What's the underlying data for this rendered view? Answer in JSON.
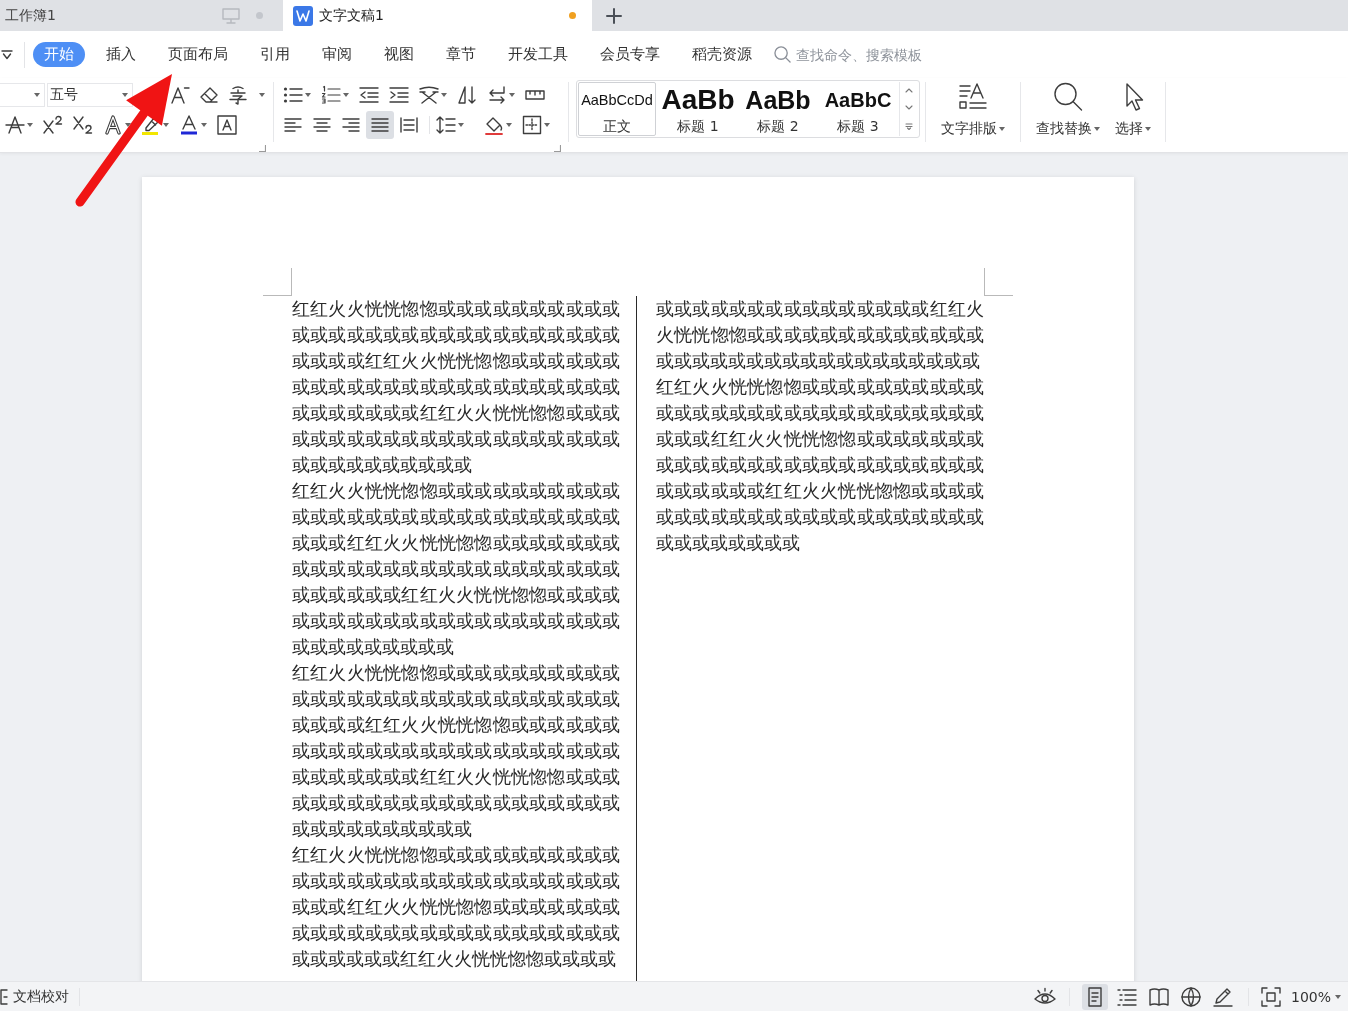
{
  "tabs": [
    {
      "label": "工作簿1",
      "kind": "spreadsheet",
      "selected": false,
      "unsaved": true
    },
    {
      "label": "文字文稿1",
      "kind": "document",
      "selected": true,
      "unsaved": true
    }
  ],
  "ribbon_tabs": [
    {
      "label": "开始",
      "selected": true
    },
    {
      "label": "插入",
      "selected": false
    },
    {
      "label": "页面布局",
      "selected": false
    },
    {
      "label": "引用",
      "selected": false
    },
    {
      "label": "审阅",
      "selected": false
    },
    {
      "label": "视图",
      "selected": false
    },
    {
      "label": "章节",
      "selected": false
    },
    {
      "label": "开发工具",
      "selected": false
    },
    {
      "label": "会员专享",
      "selected": false
    },
    {
      "label": "稻壳资源",
      "selected": false
    }
  ],
  "search": {
    "placeholder": "查找命令、搜索模板"
  },
  "font_group": {
    "font_size": "五号"
  },
  "paragraph_group": {
    "alignment": [
      {
        "kind": "left",
        "selected": false
      },
      {
        "kind": "center",
        "selected": false
      },
      {
        "kind": "right",
        "selected": false
      },
      {
        "kind": "justify",
        "selected": true
      },
      {
        "kind": "distributed",
        "selected": false
      }
    ]
  },
  "styles": [
    {
      "kind": "body",
      "sample": "AaBbCcDd",
      "label": "正文",
      "selected": true
    },
    {
      "kind": "heading-1",
      "sample": "AaBb",
      "label": "标题 1",
      "selected": false
    },
    {
      "kind": "heading-2",
      "sample": "AaBb",
      "label": "标题 2",
      "selected": false
    },
    {
      "kind": "heading-3",
      "sample": "AaBbC",
      "label": "标题 3",
      "selected": false
    }
  ],
  "tool_groups": [
    [
      {
        "kind": "text-layout",
        "label": "文字排版"
      }
    ],
    [
      {
        "kind": "find-replace",
        "label": "查找替换"
      },
      {
        "kind": "select",
        "label": "选择"
      }
    ]
  ],
  "document": {
    "columns": [
      {
        "paragraphs": [
          "红红火火恍恍惚惚或或或或或或或或或或或或或或或或或或或或或或或或或或或或或或或或红红火火恍恍惚惚或或或或或或或或或或或或或或或或或或或或或或或或或或或或或或或红红火火恍恍惚惚或或或或或或或或或或或或或或或或或或或或或或或或或或或或或或或",
          "红红火火恍恍惚惚或或或或或或或或或或或或或或或或或或或或或或或或或或或或或或或红红火火恍恍惚惚或或或或或或或或或或或或或或或或或或或或或或或或或或或或或或或红红火火恍恍惚惚或或或或或或或或或或或或或或或或或或或或或或或或或或或或或或或",
          "红红火火恍恍惚惚或或或或或或或或或或或或或或或或或或或或或或或或或或或或或或或或红红火火恍恍惚惚或或或或或或或或或或或或或或或或或或或或或或或或或或或或或或或红红火火恍恍惚惚或或或或或或或或或或或或或或或或或或或或或或或或或或或或或或或",
          "红红火火恍恍惚惚或或或或或或或或或或或或或或或或或或或或或或或或或或或或或或或红红火火恍恍惚惚或或或或或或或或或或或或或或或或或或或或或或或或或或或或或或或红红火火恍恍惚惚或或或或"
        ]
      },
      {
        "paragraphs": [
          "或或或或或或或或或或或或或或或红红火火恍恍惚惚或或或或或或或或或或或或或或或或或或或或或或或或或或或或或或或",
          "红红火火恍恍惚惚或或或或或或或或或或或或或或或或或或或或或或或或或或或或或或或红红火火恍恍惚惚或或或或或或或或或或或或或或或或或或或或或或或或或或或或或或或红红火火恍恍惚惚或或或或或或或或或或或或或或或或或或或或或或或或或或或或或或"
        ]
      }
    ]
  },
  "status_bar": {
    "proofread": "文档校对",
    "views": [
      {
        "kind": "page",
        "selected": true
      },
      {
        "kind": "outline",
        "selected": false
      },
      {
        "kind": "read",
        "selected": false
      },
      {
        "kind": "web",
        "selected": false
      },
      {
        "kind": "write",
        "selected": false
      }
    ],
    "zoom": "100%"
  }
}
